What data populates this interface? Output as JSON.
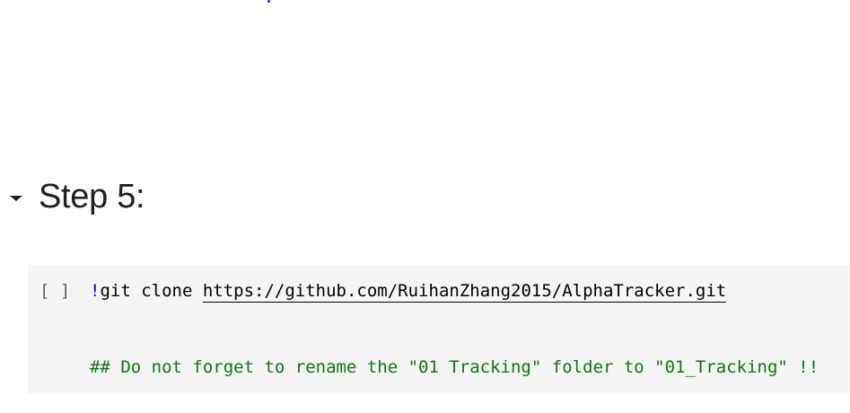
{
  "section": {
    "title": "Step 5:",
    "toggle_icon": "caret-down-icon"
  },
  "cell": {
    "run_indicator": "[ ]",
    "code": {
      "bang": "!",
      "command": "git clone ",
      "url": "https://github.com/RuihanZhang2015/AlphaTracker.git",
      "comment": "## Do not forget to rename the \"01 Tracking\" folder to \"01_Tracking\" !!"
    }
  },
  "colors": {
    "cell_background": "#f5f5f5",
    "comment": "#0a7a0a",
    "bang": "#0000ff",
    "text": "#000000"
  }
}
